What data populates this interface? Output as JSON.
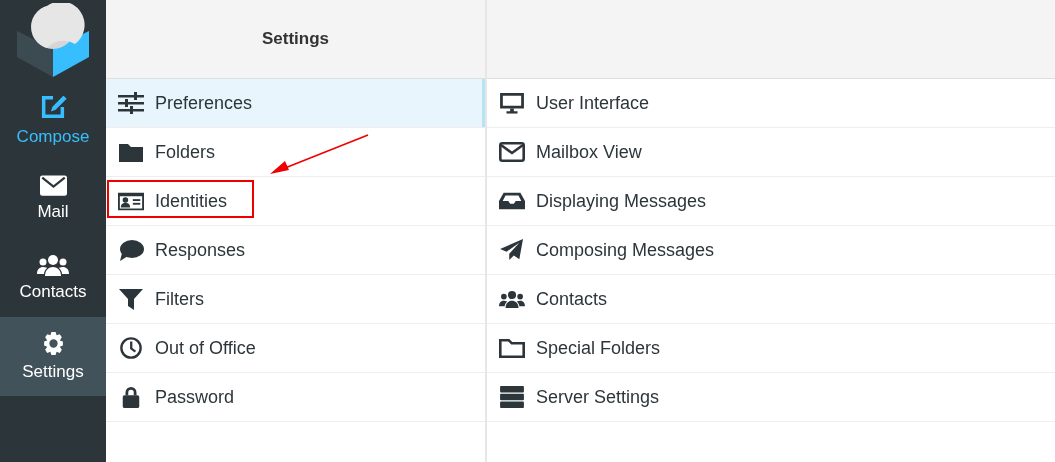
{
  "sidebar": {
    "items": [
      {
        "label": "Compose",
        "kind": "primary",
        "selected": false
      },
      {
        "label": "Mail",
        "kind": "nav",
        "selected": false
      },
      {
        "label": "Contacts",
        "kind": "nav",
        "selected": false
      },
      {
        "label": "Settings",
        "kind": "nav",
        "selected": true
      }
    ]
  },
  "sections": {
    "title": "Settings",
    "items": [
      {
        "label": "Preferences",
        "selected": true,
        "highlighted": false
      },
      {
        "label": "Folders",
        "selected": false,
        "highlighted": false
      },
      {
        "label": "Identities",
        "selected": false,
        "highlighted": true
      },
      {
        "label": "Responses",
        "selected": false,
        "highlighted": false
      },
      {
        "label": "Filters",
        "selected": false,
        "highlighted": false
      },
      {
        "label": "Out of Office",
        "selected": false,
        "highlighted": false
      },
      {
        "label": "Password",
        "selected": false,
        "highlighted": false
      }
    ]
  },
  "preferences": {
    "items": [
      {
        "label": "User Interface",
        "selected": false
      },
      {
        "label": "Mailbox View",
        "selected": false
      },
      {
        "label": "Displaying Messages",
        "selected": false
      },
      {
        "label": "Composing Messages",
        "selected": false
      },
      {
        "label": "Contacts",
        "selected": false
      },
      {
        "label": "Special Folders",
        "selected": false
      },
      {
        "label": "Server Settings",
        "selected": false
      }
    ]
  }
}
